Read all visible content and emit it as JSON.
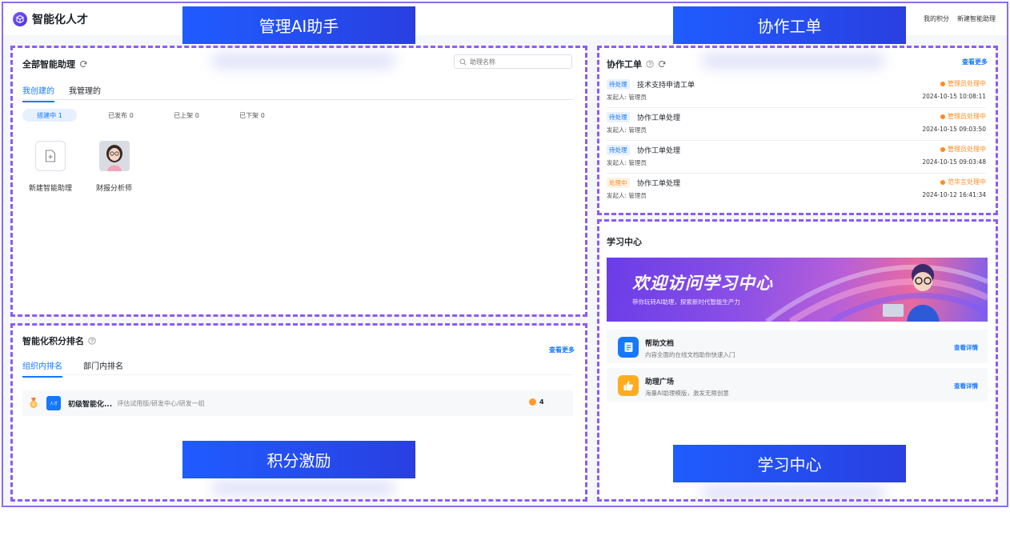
{
  "app": {
    "logo_text": "智能化人才",
    "links": [
      "我的积分",
      "新建智能助理"
    ]
  },
  "banners": {
    "manage": "管理AI助手",
    "workorder": "协作工单",
    "points": "积分激励",
    "learning": "学习中心"
  },
  "assistants_panel": {
    "title": "全部智能助理",
    "search_placeholder": "助理名称",
    "tabs": [
      "我创建的",
      "我管理的"
    ],
    "filters": [
      "搭建中 1",
      "已发布 0",
      "已上架 0",
      "已下架 0"
    ],
    "items": [
      {
        "label": "新建智能助理",
        "icon": "add-file-icon"
      },
      {
        "label": "财报分析师",
        "icon": "avatar"
      }
    ]
  },
  "ranking_panel": {
    "title": "智能化积分排名",
    "more": "查看更多",
    "tabs": [
      "组织内排名",
      "部门内排名"
    ],
    "rows": [
      {
        "avatar": "人才",
        "name": "初级智能化...",
        "dept": "评估试用版/研发中心/研发一组",
        "score": "4"
      }
    ]
  },
  "workorder_panel": {
    "title": "协作工单",
    "more": "查看更多",
    "tickets": [
      {
        "tag": "待处理",
        "tag_color": "#1677ff",
        "title": "技术支持申请工单",
        "by": "发起人: 管理员",
        "status": "管理员处理中",
        "time": "2024-10-15 10:08:11"
      },
      {
        "tag": "待处理",
        "tag_color": "#1677ff",
        "title": "协作工单处理",
        "by": "发起人: 管理员",
        "status": "管理员处理中",
        "time": "2024-10-15 09:03:50"
      },
      {
        "tag": "待处理",
        "tag_color": "#1677ff",
        "title": "协作工单处理",
        "by": "发起人: 管理员",
        "status": "管理员处理中",
        "time": "2024-10-15 09:03:48"
      },
      {
        "tag": "处理中",
        "tag_color": "#ff8a1f",
        "title": "协作工单处理",
        "by": "发起人: 管理员",
        "status": "范华言处理中",
        "time": "2024-10-12 16:41:34"
      }
    ]
  },
  "learning_panel": {
    "title": "学习中心",
    "banner_title": "欢迎访问学习中心",
    "banner_sub": "带你玩转AI助理，探索新时代智能生产力",
    "items": [
      {
        "title": "帮助文档",
        "desc": "内容全面的在线文档助你快速入门",
        "link": "查看详情",
        "icon": "document-icon",
        "color": "#1677ff"
      },
      {
        "title": "助理广场",
        "desc": "海量AI助理模版，激发无限创意",
        "link": "查看详情",
        "icon": "thumbs-up-icon",
        "color": "#ffad1f"
      }
    ]
  },
  "colors": {
    "accent": "#1677ff",
    "warning": "#ff8a1f",
    "dashed_border": "#8a5cf6",
    "banner": "#1f5cff"
  }
}
